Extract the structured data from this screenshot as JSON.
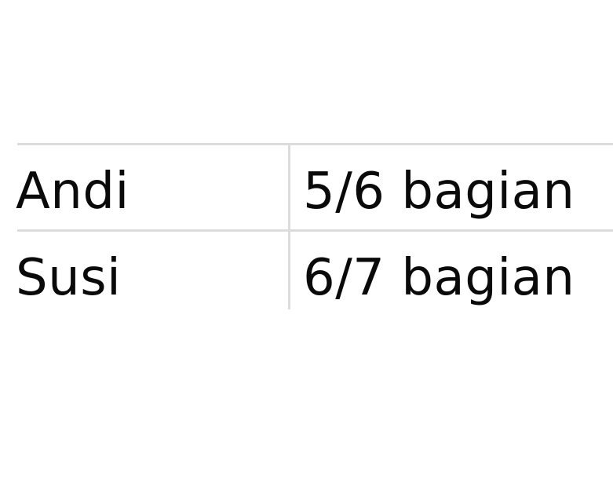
{
  "table": {
    "rows": [
      {
        "name": "Andi",
        "value": "5/6 bagian"
      },
      {
        "name": "Susi",
        "value": "6/7 bagian"
      }
    ]
  },
  "colors": {
    "text": "#0a0a0a",
    "grid": "#dcdcdc",
    "background": "#ffffff"
  }
}
